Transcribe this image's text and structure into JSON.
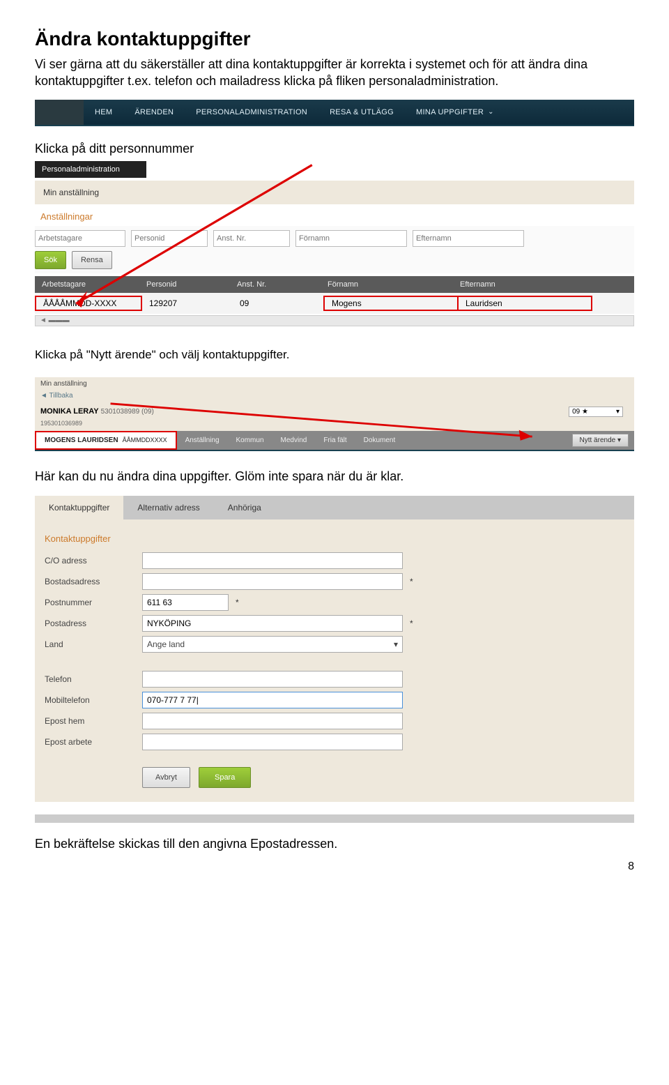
{
  "title": "Ändra kontaktuppgifter",
  "intro": "Vi ser gärna att du säkerställer att dina kontaktuppgifter är korrekta i systemet och för att ändra dina kontaktuppgifter t.ex. telefon och mailadress klicka på fliken personaladministration.",
  "nav": {
    "items": [
      "HEM",
      "ÄRENDEN",
      "PERSONALADMINISTRATION",
      "RESA & UTLÄGG",
      "MINA UPPGIFTER"
    ],
    "chev": "⌄"
  },
  "caption2": "Klicka på ditt personnummer",
  "shot2": {
    "crumb": "Personaladministration",
    "minanst": "Min anställning",
    "anst": "Anställningar",
    "search_fields": [
      "Arbetstagare",
      "Personid",
      "Anst. Nr.",
      "Förnamn",
      "Efternamn"
    ],
    "btn_sok": "Sök",
    "btn_rensa": "Rensa",
    "headers": [
      "Arbetstagare",
      "Personid",
      "Anst. Nr.",
      "Förnamn",
      "Efternamn"
    ],
    "row": {
      "arbets": "ÅÅÅÅMMDD-XXXX",
      "personid": "129207",
      "anstnr": "09",
      "fornamn": "Mogens",
      "efternamn": "Lauridsen"
    },
    "scrollhint": "◄        ▬▬▬"
  },
  "caption3": "Klicka på \"Nytt ärende\" och välj kontaktuppgifter.",
  "shot3": {
    "minanst": "Min anställning",
    "tillbaka": "◄ Tillbaka",
    "name": "MONIKA LERAY",
    "nameid": "5301038989 (09)",
    "idline": "195301036989",
    "name2": "MOGENS LAURIDSEN",
    "name2id": "ÅÅMMDDXXXX",
    "tabs": [
      "Anställning",
      "Kommun",
      "Medvind",
      "Fria fält",
      "Dokument"
    ],
    "star": "09 ★",
    "nytt": "Nytt ärende ▾"
  },
  "caption4a": "Här kan du nu ändra dina uppgifter. Glöm inte spara när du är klar.",
  "form": {
    "tabs": [
      "Kontaktuppgifter",
      "Alternativ adress",
      "Anhöriga"
    ],
    "heading": "Kontaktuppgifter",
    "rows": {
      "co": "C/O adress",
      "bostad": "Bostadsadress",
      "postnr": "Postnummer",
      "postnr_val": "611 63",
      "postadr": "Postadress",
      "postadr_val": "NYKÖPING",
      "land": "Land",
      "land_val": "Ange land",
      "telefon": "Telefon",
      "mobil": "Mobiltelefon",
      "mobil_val": "070-777 7 77|",
      "eposthem": "Epost hem",
      "epostarb": "Epost arbete",
      "star": "*"
    },
    "btn_avbryt": "Avbryt",
    "btn_spara": "Spara"
  },
  "footer": "En bekräftelse skickas till den angivna Epostadressen.",
  "pagenum": "8"
}
